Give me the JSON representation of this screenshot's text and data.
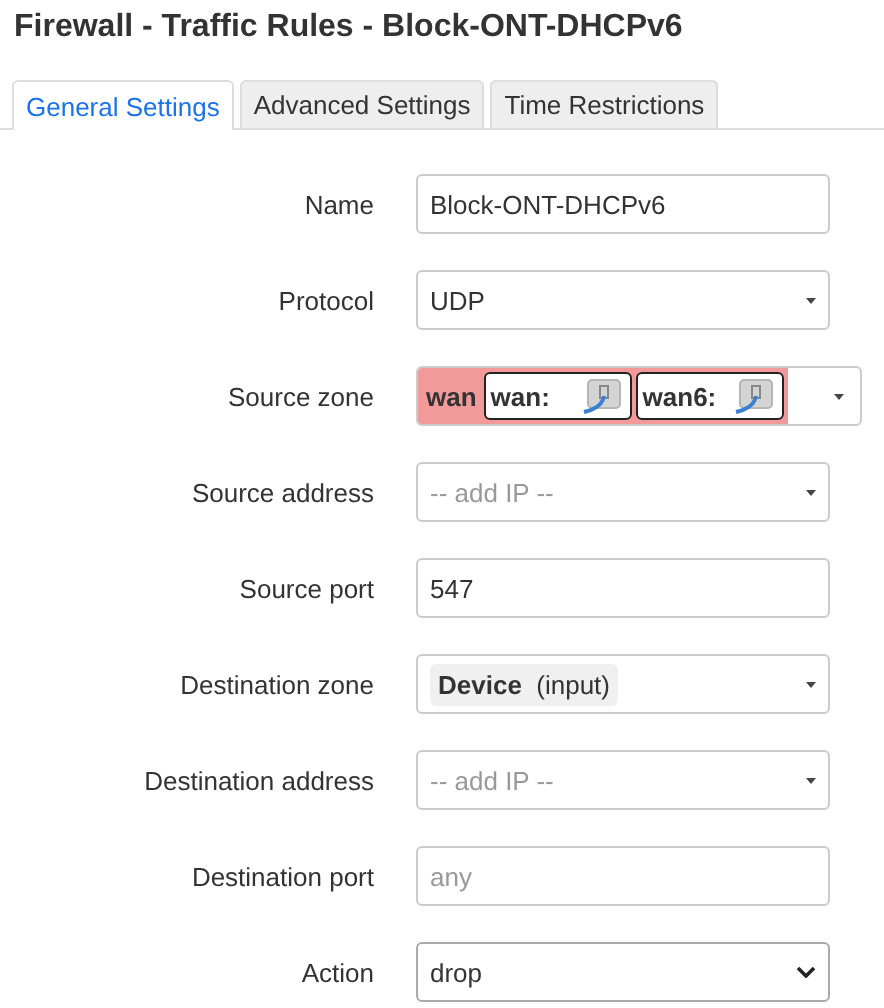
{
  "title": "Firewall - Traffic Rules - Block-ONT-DHCPv6",
  "tabs": [
    {
      "label": "General Settings",
      "selected": true
    },
    {
      "label": "Advanced Settings",
      "selected": false
    },
    {
      "label": "Time Restrictions",
      "selected": false
    }
  ],
  "fields": [
    {
      "kind": "text",
      "label": "Name",
      "value": "Block-ONT-DHCPv6"
    },
    {
      "kind": "select",
      "label": "Protocol",
      "value": "UDP"
    },
    {
      "kind": "zone-multi",
      "label": "Source zone",
      "zone": "wan",
      "color": "#f29a9a",
      "networks": [
        "wan:",
        "wan6:"
      ]
    },
    {
      "kind": "select",
      "label": "Source address",
      "placeholder": "-- add IP --"
    },
    {
      "kind": "text",
      "label": "Source port",
      "value": "547"
    },
    {
      "kind": "zone",
      "label": "Destination zone",
      "zone": "Device",
      "note": "(input)"
    },
    {
      "kind": "select",
      "label": "Destination address",
      "placeholder": "-- add IP --"
    },
    {
      "kind": "text",
      "label": "Destination port",
      "placeholder": "any"
    },
    {
      "kind": "native",
      "label": "Action",
      "value": "drop"
    }
  ]
}
